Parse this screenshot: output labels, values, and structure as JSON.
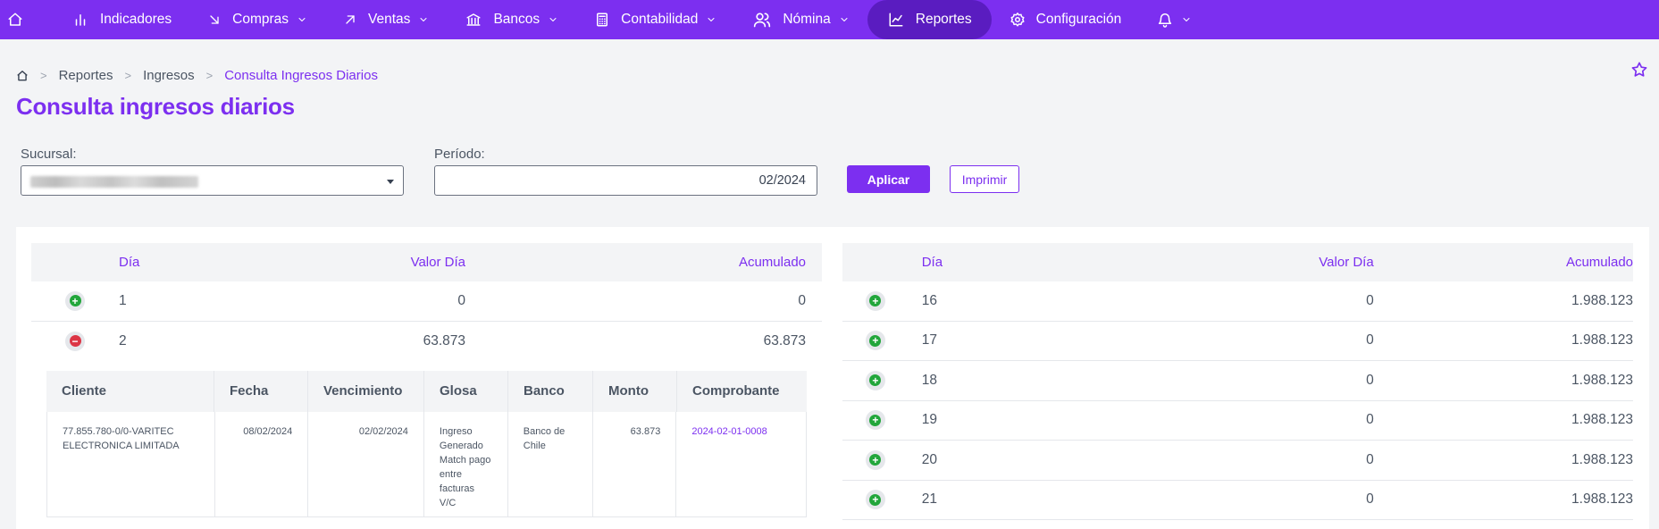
{
  "nav": {
    "items": [
      {
        "label": "Indicadores",
        "icon": "bar-chart-icon",
        "dropdown": false
      },
      {
        "label": "Compras",
        "icon": "arrow-down-right-icon",
        "dropdown": true
      },
      {
        "label": "Ventas",
        "icon": "arrow-up-right-icon",
        "dropdown": true
      },
      {
        "label": "Bancos",
        "icon": "bank-icon",
        "dropdown": true
      },
      {
        "label": "Contabilidad",
        "icon": "calculator-icon",
        "dropdown": true
      },
      {
        "label": "Nómina",
        "icon": "users-icon",
        "dropdown": true
      },
      {
        "label": "Reportes",
        "icon": "line-chart-icon",
        "dropdown": false,
        "active": true
      },
      {
        "label": "Configuración",
        "icon": "gear-icon",
        "dropdown": false
      }
    ]
  },
  "breadcrumb": {
    "items": [
      "Reportes",
      "Ingresos"
    ],
    "current": "Consulta Ingresos Diarios"
  },
  "page": {
    "title": "Consulta ingresos diarios"
  },
  "filters": {
    "sucursal_label": "Sucursal:",
    "periodo_label": "Período:",
    "periodo_value": "02/2024",
    "apply_label": "Aplicar",
    "print_label": "Imprimir"
  },
  "table_headers": {
    "dia": "Día",
    "valor": "Valor Día",
    "acumulado": "Acumulado"
  },
  "left_rows": [
    {
      "dia": "1",
      "valor": "0",
      "acumulado": "0",
      "expanded": false
    },
    {
      "dia": "2",
      "valor": "63.873",
      "acumulado": "63.873",
      "expanded": true
    }
  ],
  "right_rows": [
    {
      "dia": "16",
      "valor": "0",
      "acumulado": "1.988.123"
    },
    {
      "dia": "17",
      "valor": "0",
      "acumulado": "1.988.123"
    },
    {
      "dia": "18",
      "valor": "0",
      "acumulado": "1.988.123"
    },
    {
      "dia": "19",
      "valor": "0",
      "acumulado": "1.988.123"
    },
    {
      "dia": "20",
      "valor": "0",
      "acumulado": "1.988.123"
    },
    {
      "dia": "21",
      "valor": "0",
      "acumulado": "1.988.123"
    }
  ],
  "detail": {
    "headers": [
      "Cliente",
      "Fecha",
      "Vencimiento",
      "Glosa",
      "Banco",
      "Monto",
      "Comprobante"
    ],
    "rows": [
      {
        "cliente": "77.855.780-0/0-VARITEC ELECTRONICA LIMITADA",
        "fecha": "08/02/2024",
        "vencimiento": "02/02/2024",
        "glosa": "Ingreso Generado Match pago entre facturas V/C",
        "banco": "Banco de Chile",
        "monto": "63.873",
        "comprobante": "2024-02-01-0008"
      }
    ]
  }
}
